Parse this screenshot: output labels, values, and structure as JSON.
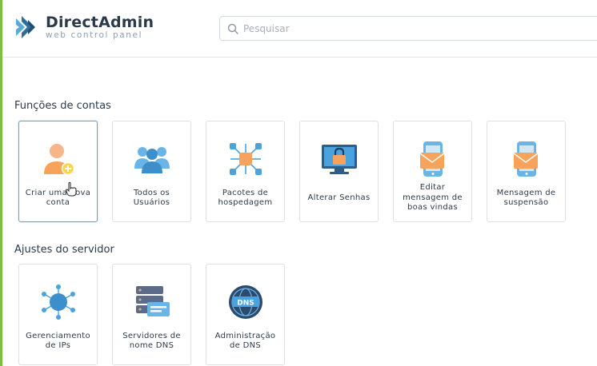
{
  "header": {
    "logo": {
      "name": "DirectAdmin",
      "tagline": "web control panel"
    },
    "search": {
      "placeholder": "Pesquisar",
      "value": ""
    }
  },
  "sections": [
    {
      "title": "Funções de contas",
      "cards": [
        {
          "label": "Criar uma nova conta",
          "icon": "add-user-icon"
        },
        {
          "label": "Todos os Usuários",
          "icon": "users-group-icon"
        },
        {
          "label": "Pacotes de hospedagem",
          "icon": "package-network-icon"
        },
        {
          "label": "Alterar Senhas",
          "icon": "monitor-lock-icon"
        },
        {
          "label": "Editar mensagem de boas vindas",
          "icon": "phone-mail-icon"
        },
        {
          "label": "Mensagem de suspensão",
          "icon": "phone-mail-icon"
        }
      ]
    },
    {
      "title": "Ajustes do servidor",
      "cards": [
        {
          "label": "Gerenciamento de IPs",
          "icon": "ip-network-icon"
        },
        {
          "label": "Servidores de nome DNS",
          "icon": "server-stack-icon"
        },
        {
          "label": "Administração de DNS",
          "icon": "dns-globe-icon"
        }
      ]
    }
  ],
  "colors": {
    "accent": "#7ac143",
    "brand_dark": "#2b3a4a",
    "active_border": "#5aa9d6",
    "icon_blue": "#4aa3df",
    "icon_orange": "#f7a35c"
  }
}
